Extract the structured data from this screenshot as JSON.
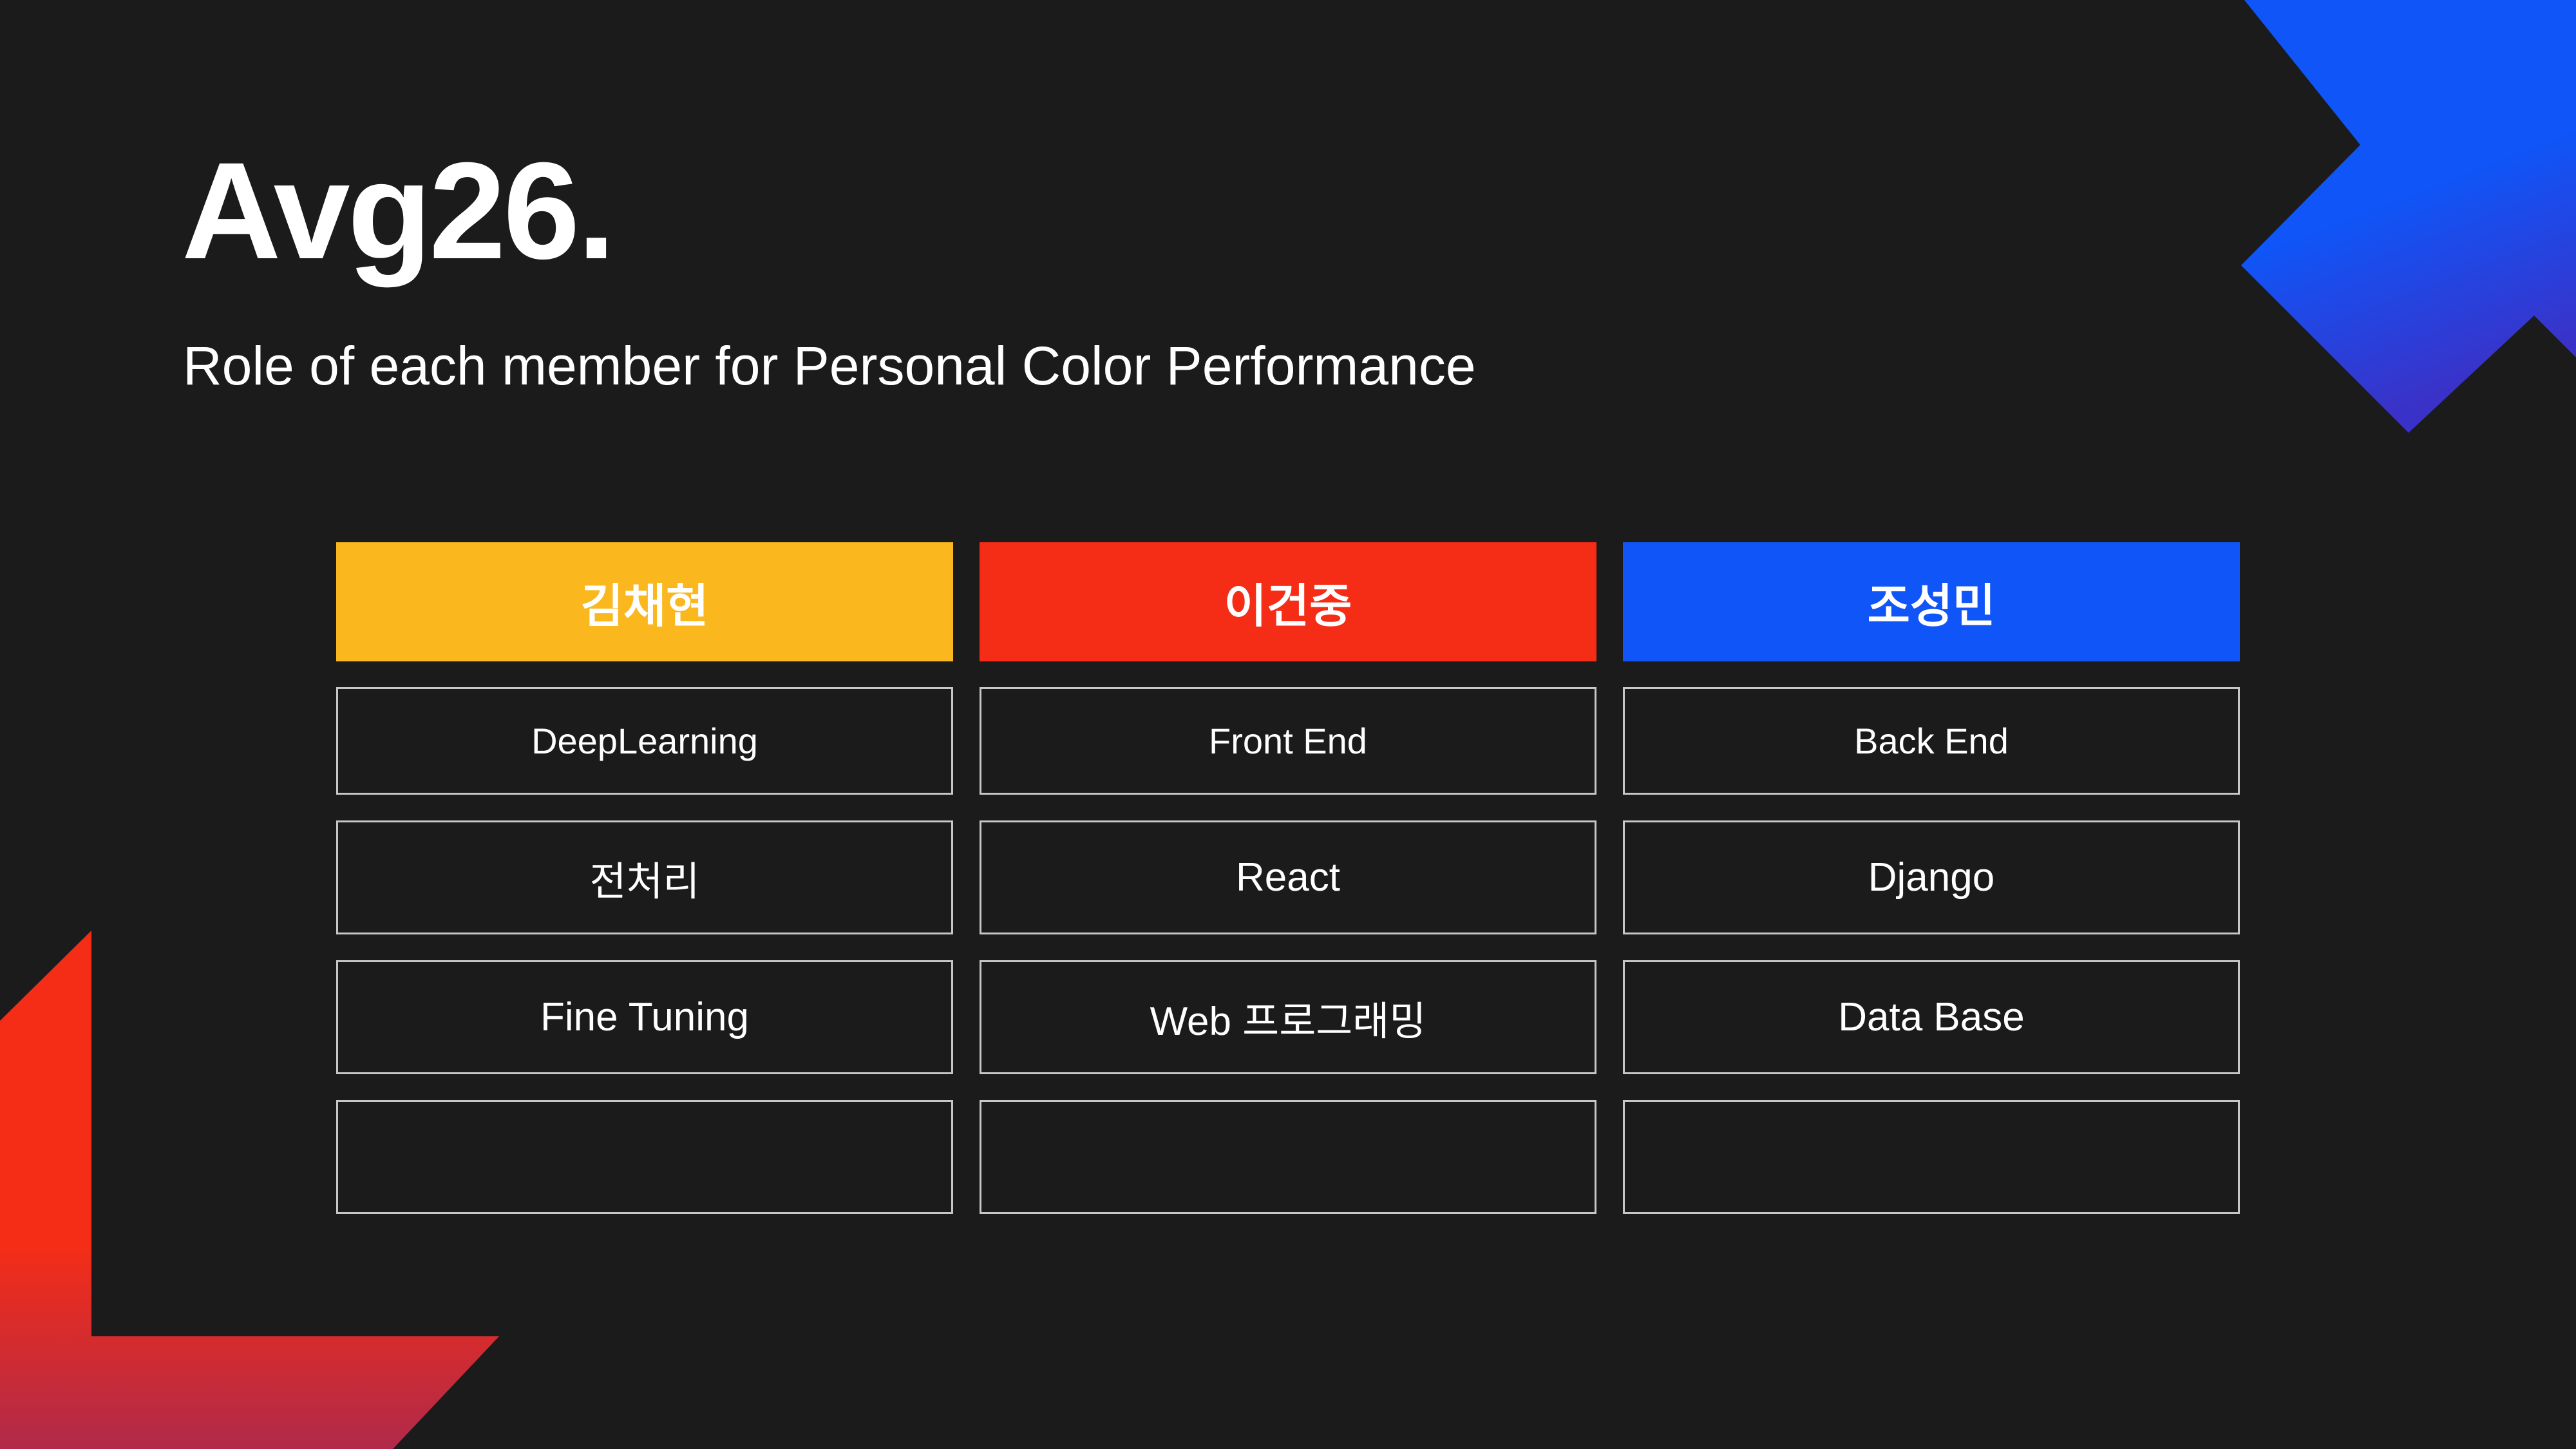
{
  "slide": {
    "title": "Avg26.",
    "subtitle": "Role of each member for Personal Color Performance"
  },
  "colors": {
    "background": "#1b1b1c",
    "yellow": "#fab71e",
    "red": "#f52d16",
    "blue": "#1055f7",
    "cell_border": "#c7c7c7"
  },
  "members": [
    {
      "name": "김채현",
      "color": "#fab71e",
      "roles": [
        "DeepLearning",
        "전처리",
        "Fine Tuning",
        ""
      ]
    },
    {
      "name": "이건중",
      "color": "#f52d16",
      "roles": [
        "Front End",
        "React",
        "Web 프로그래밍",
        ""
      ]
    },
    {
      "name": "조성민",
      "color": "#1055f7",
      "roles": [
        "Back End",
        "Django",
        "Data Base",
        ""
      ]
    }
  ]
}
